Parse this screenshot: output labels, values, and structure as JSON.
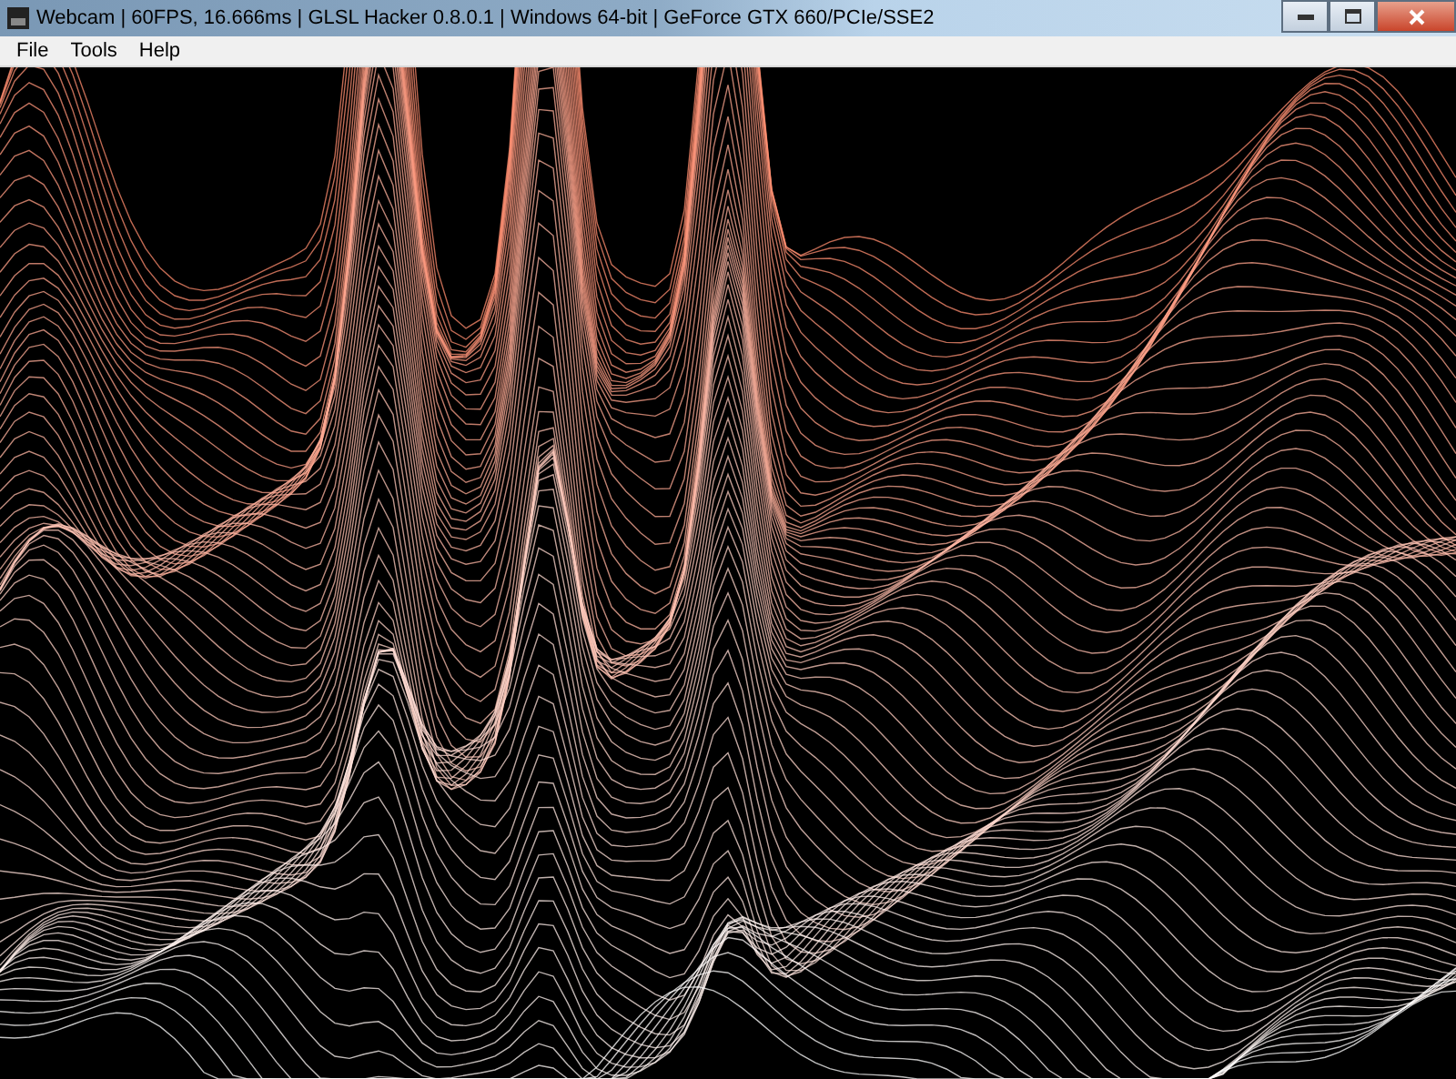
{
  "window": {
    "title": "Webcam | 60FPS, 16.666ms | GLSL Hacker 0.8.0.1 | Windows 64-bit | GeForce GTX 660/PCIe/SSE2"
  },
  "menu": [
    "File",
    "Tools",
    "Help"
  ]
}
